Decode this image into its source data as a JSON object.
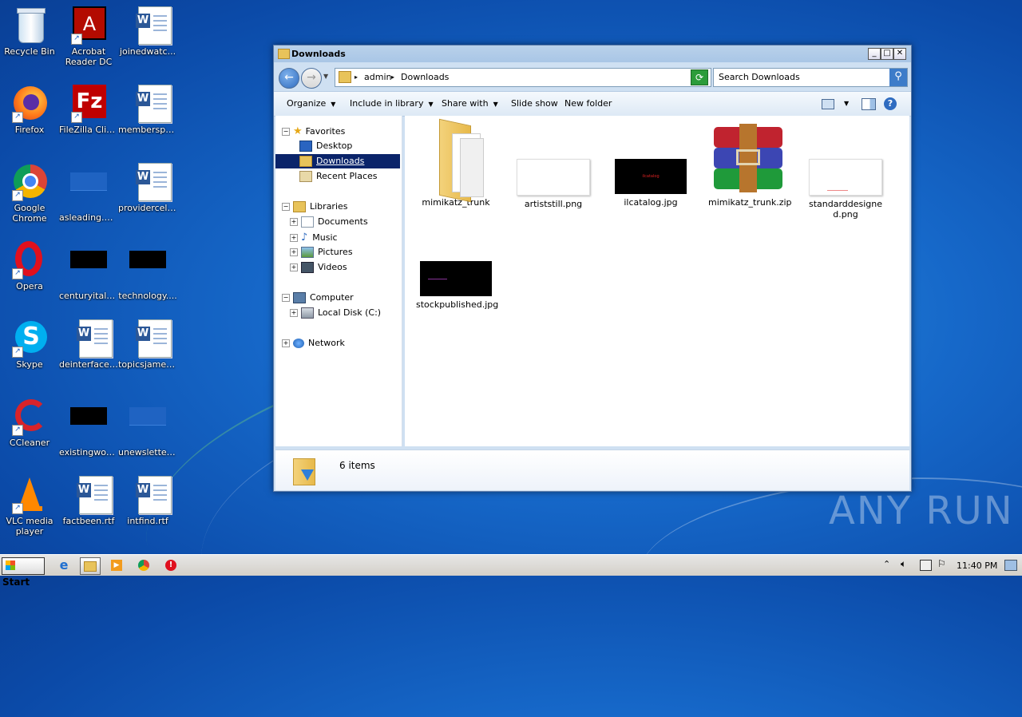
{
  "desktop": {
    "icons": [
      {
        "label": "Recycle Bin"
      },
      {
        "label": "Acrobat Reader DC"
      },
      {
        "label": "joinedwatc..."
      },
      {
        "label": "Firefox"
      },
      {
        "label": "FileZilla Client"
      },
      {
        "label": "membersph..."
      },
      {
        "label": "Google Chrome"
      },
      {
        "label": "asleading.png"
      },
      {
        "label": "providercell.rtf"
      },
      {
        "label": "Opera"
      },
      {
        "label": "centuryitaly...."
      },
      {
        "label": "technology...."
      },
      {
        "label": "Skype"
      },
      {
        "label": "deinterface.rtf"
      },
      {
        "label": "topicsjames...."
      },
      {
        "label": "CCleaner"
      },
      {
        "label": "existingwou...."
      },
      {
        "label": "unewslette...."
      },
      {
        "label": "VLC media player"
      },
      {
        "label": "factbeen.rtf"
      },
      {
        "label": "intfind.rtf"
      }
    ]
  },
  "window": {
    "title": "Downloads",
    "breadcrumb": [
      "admin",
      "Downloads"
    ],
    "search_placeholder": "Search Downloads",
    "toolbar": {
      "organize": "Organize",
      "include_in_library": "Include in library",
      "share_with": "Share with",
      "slide_show": "Slide show",
      "new_folder": "New folder"
    },
    "nav": {
      "favorites": "Favorites",
      "desktop": "Desktop",
      "downloads": "Downloads",
      "recent_places": "Recent Places",
      "libraries": "Libraries",
      "documents": "Documents",
      "music": "Music",
      "pictures": "Pictures",
      "videos": "Videos",
      "computer": "Computer",
      "local_disk": "Local Disk (C:)",
      "network": "Network"
    },
    "files": [
      {
        "name": "mimikatz_trunk",
        "thumb_text": ""
      },
      {
        "name": "artiststill.png",
        "thumb_text": ""
      },
      {
        "name": "ilcatalog.jpg",
        "thumb_text": "ilcatalog"
      },
      {
        "name": "mimikatz_trunk.zip",
        "thumb_text": ""
      },
      {
        "name": "standarddesigned.png",
        "thumb_text": ""
      },
      {
        "name": "stockpublished.jpg",
        "thumb_text": ""
      }
    ],
    "status": "6 items"
  },
  "taskbar": {
    "start": "Start",
    "clock": "11:40 PM"
  },
  "watermark": "ANY RUN"
}
